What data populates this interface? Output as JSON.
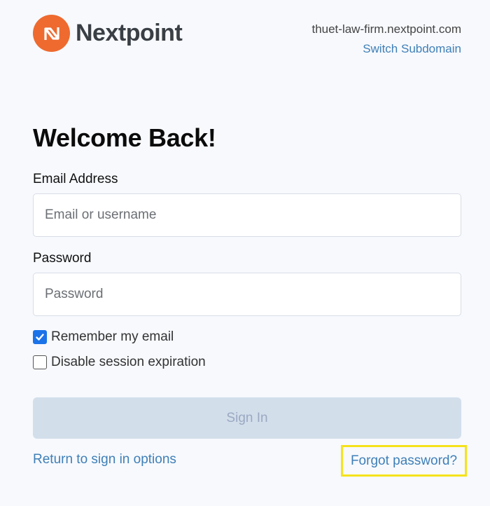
{
  "brand": {
    "name": "Nextpoint",
    "accent": "#ee6a2f"
  },
  "header": {
    "subdomain": "thuet-law-firm.nextpoint.com",
    "switch_label": "Switch Subdomain"
  },
  "form": {
    "title": "Welcome Back!",
    "email_label": "Email Address",
    "email_placeholder": "Email or username",
    "email_value": "",
    "password_label": "Password",
    "password_placeholder": "Password",
    "password_value": "",
    "remember_label": "Remember my email",
    "remember_checked": true,
    "disable_expiration_label": "Disable session expiration",
    "disable_expiration_checked": false,
    "signin_label": "Sign In",
    "return_label": "Return to sign in options",
    "forgot_label": "Forgot password?"
  },
  "colors": {
    "link": "#3f7fb7",
    "button_disabled_bg": "#d3deeb",
    "highlight": "#f5e21c",
    "checkbox": "#1a73e8"
  }
}
